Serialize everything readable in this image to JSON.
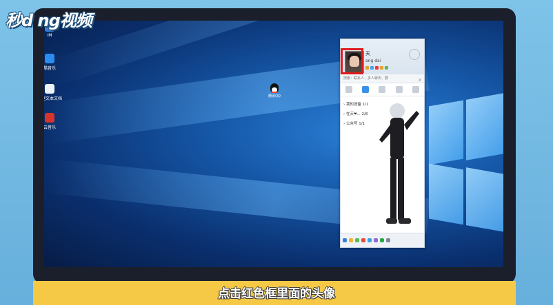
{
  "brand": {
    "watermark": "秒d ng视频"
  },
  "caption": {
    "text": "点击红色框里面的头像"
  },
  "desktop": {
    "icons": [
      {
        "label": "IM"
      },
      {
        "label": "酷音乐"
      },
      {
        "label": "新建文本文档"
      },
      {
        "label": "云音乐"
      }
    ],
    "qq_shortcut_label": "腾讯QQ"
  },
  "qq_panel": {
    "nickname": "天",
    "signature": "ang dai",
    "search_placeholder": "搜索：联系人、多人聊天、群",
    "groups": [
      {
        "label": "我的设备 1/1"
      },
      {
        "label": "在天❤... 2/8"
      },
      {
        "label": "公众号 1/1"
      }
    ]
  },
  "colors": {
    "highlight_box": "#e01b1b",
    "caption_bar": "#f5c945",
    "page_bg": "#6fb6df"
  }
}
